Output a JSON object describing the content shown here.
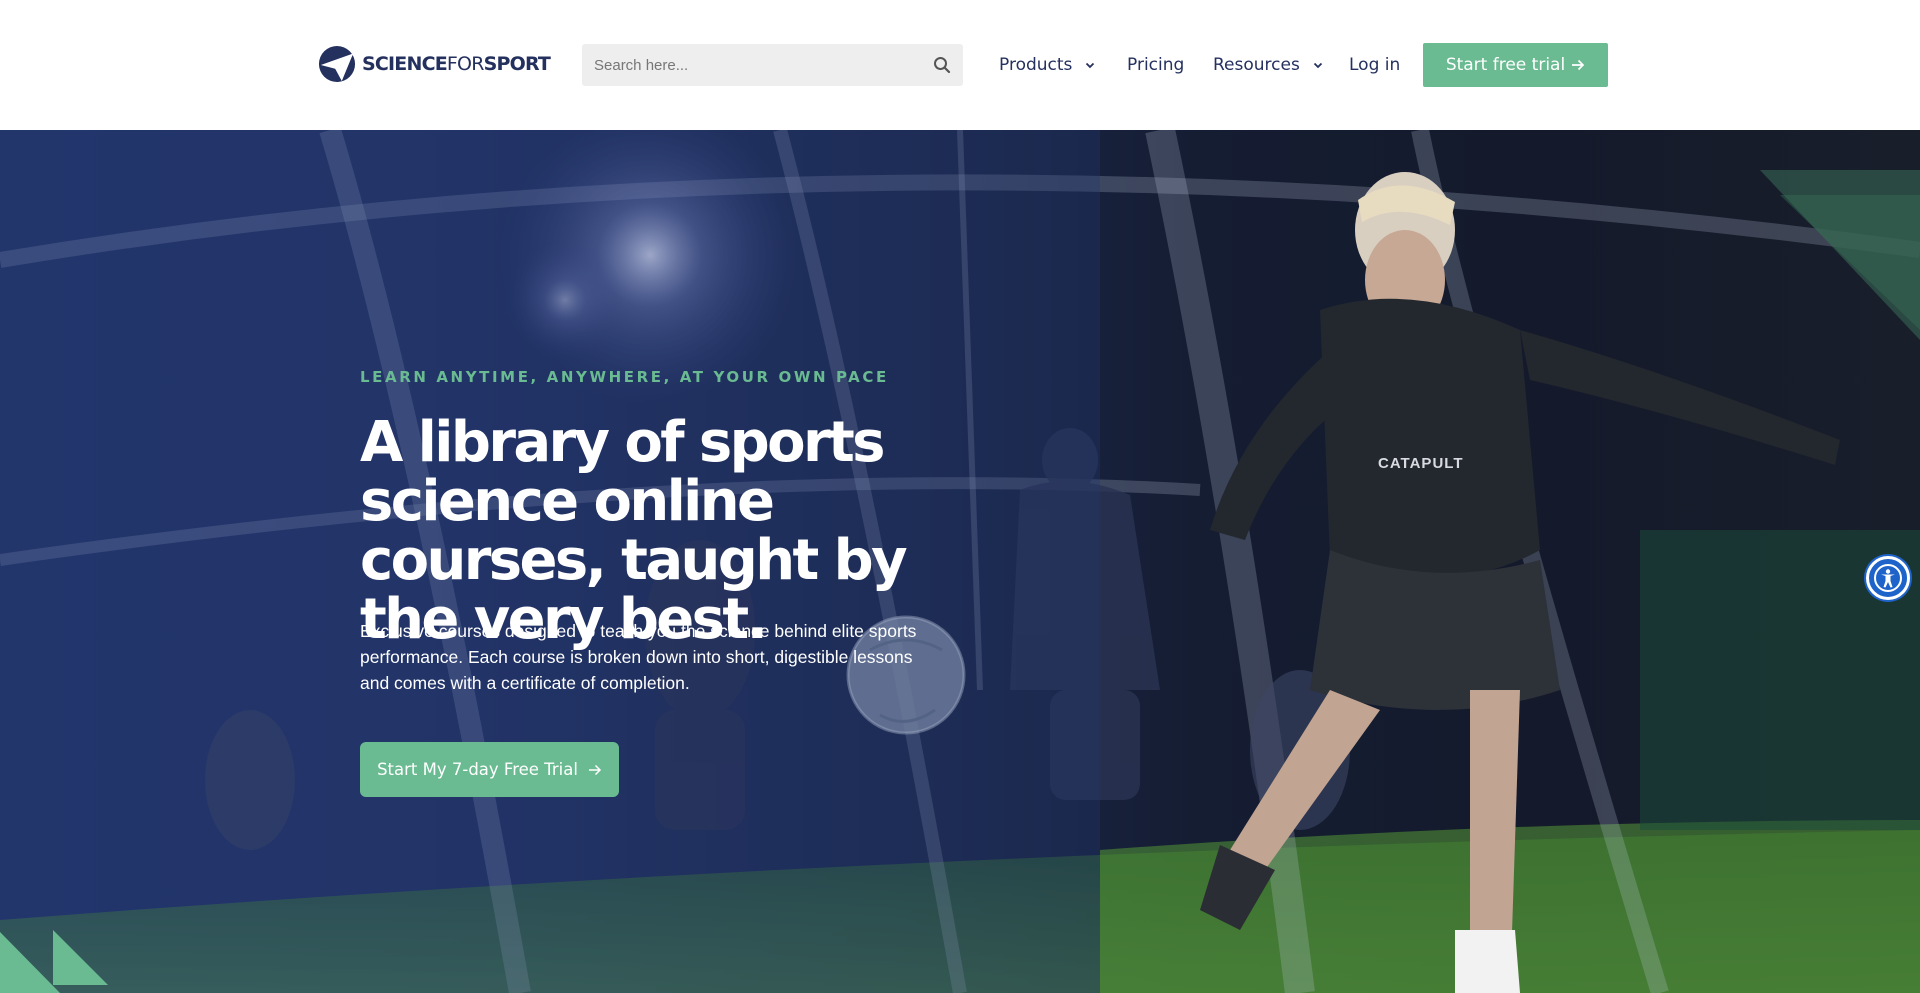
{
  "header": {
    "logo": {
      "bold": "SCIENCE",
      "light": "FOR",
      "bold2": "SPORT"
    },
    "search": {
      "placeholder": "Search here..."
    },
    "nav": [
      {
        "label": "Products",
        "has_dropdown": true
      },
      {
        "label": "Pricing",
        "has_dropdown": false
      },
      {
        "label": "Resources",
        "has_dropdown": true
      },
      {
        "label": "Log in",
        "has_dropdown": false
      }
    ],
    "cta": {
      "label": "Start free trial",
      "icon": "arrow-right-icon"
    }
  },
  "hero": {
    "eyebrow": "LEARN ANYTIME, ANYWHERE, AT YOUR OWN PACE",
    "headline": "A library of sports science online courses, taught by the very best.",
    "subtext": "Exclusive courses designed to teach you the science behind elite sports performance. Each course is broken down into short, digestible lessons and comes with a certificate of completion.",
    "cta": {
      "label": "Start My 7-day Free Trial",
      "icon": "arrow-right-icon"
    },
    "background_image_text": "CATAPULT"
  },
  "accessibility_button": {
    "icon": "accessibility-icon"
  },
  "colors": {
    "brand_navy": "#24305e",
    "accent_green": "#6abb91",
    "hero_overlay": "#23366b",
    "accessibility_blue": "#1d63c9"
  }
}
